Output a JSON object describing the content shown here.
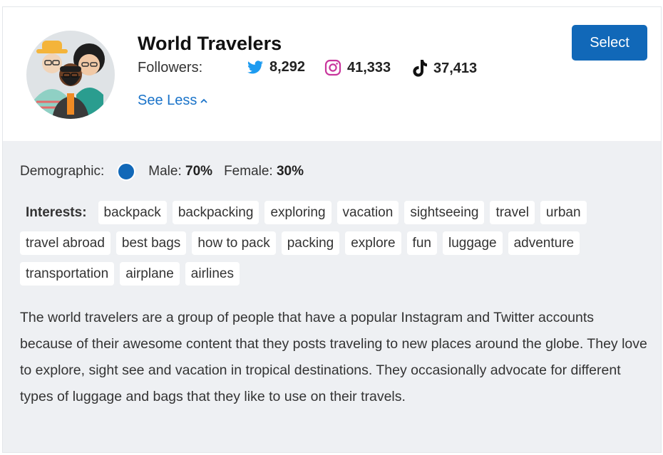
{
  "profile": {
    "name": "World Travelers",
    "followers_label": "Followers:",
    "see_less_label": "See Less",
    "select_label": "Select",
    "stats": [
      {
        "network": "twitter",
        "icon": "twitter-icon",
        "count": "8,292",
        "color": "#1d9bf0"
      },
      {
        "network": "instagram",
        "icon": "instagram-icon",
        "count": "41,333",
        "color": "#c8369c"
      },
      {
        "network": "tiktok",
        "icon": "tiktok-icon",
        "count": "37,413",
        "color": "#111111"
      }
    ]
  },
  "demographic": {
    "label": "Demographic:",
    "male_label": "Male:",
    "male_value": "70%",
    "female_label": "Female:",
    "female_value": "30%",
    "dot_color": "#1168b8"
  },
  "interests": {
    "label": "Interests:",
    "tags": [
      "backpack",
      "backpacking",
      "exploring",
      "vacation",
      "sightseeing",
      "travel",
      "urban",
      "travel abroad",
      "best bags",
      "how to pack",
      "packing",
      "explore",
      "fun",
      "luggage",
      "adventure",
      "transportation",
      "airplane",
      "airlines"
    ]
  },
  "description": "The world travelers are a group of people that have a popular Instagram and Twitter accounts because of their awesome content that they posts traveling to new places around the globe. They love to explore, sight see and vacation in tropical destinations. They occasionally advocate for different types of luggage and bags that they like to use on their travels.",
  "colors": {
    "accent": "#1168b8",
    "link": "#1a73c9",
    "panel_bg": "#eef0f3"
  }
}
